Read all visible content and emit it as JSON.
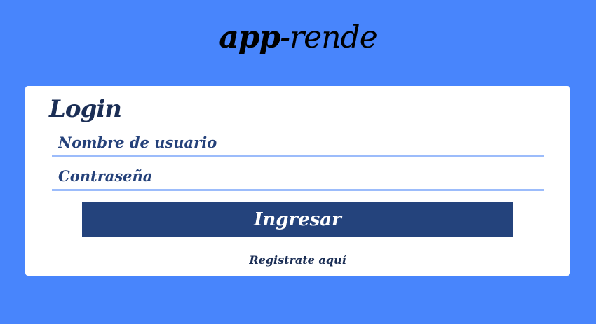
{
  "app": {
    "title_bold": "app",
    "title_rest": "-rende"
  },
  "login": {
    "heading": "Login",
    "username_placeholder": "Nombre de usuario",
    "password_placeholder": "Contraseña",
    "submit_label": "Ingresar",
    "register_link": "Registrate aquí"
  },
  "colors": {
    "background": "#4885fc",
    "card": "#ffffff",
    "button": "#24437c",
    "field_underline": "#9cbcfb",
    "text_dark": "#1b2e55"
  }
}
